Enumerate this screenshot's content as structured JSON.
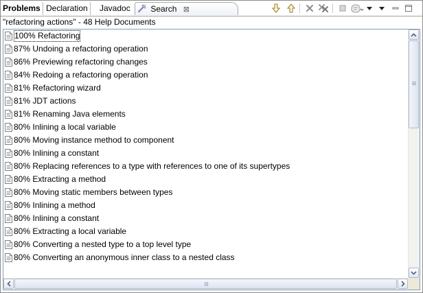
{
  "tabs": [
    {
      "label": "Problems",
      "name": "tab-problems",
      "bold": true
    },
    {
      "label": "Declaration",
      "name": "tab-declaration",
      "bold": false
    },
    {
      "label": "Javadoc",
      "name": "tab-javadoc",
      "bold": false
    },
    {
      "label": "Search",
      "name": "tab-search",
      "bold": false,
      "active": true,
      "icon": "search-icon",
      "close_icon": "close-icon"
    }
  ],
  "tab_close_glyph": "⊠",
  "toolbar": {
    "icons": [
      "next-match-arrow-icon",
      "previous-match-arrow-icon",
      "remove-selected-icon",
      "remove-all-icon",
      "stop-icon",
      "search-history-icon",
      "view-menu-icon",
      "minimize-icon",
      "maximize-icon"
    ]
  },
  "header": {
    "query": "\"refactoring actions\"",
    "separator": " - ",
    "count_text": "48 Help Documents"
  },
  "results": [
    {
      "score": "100%",
      "title": "Refactoring"
    },
    {
      "score": "87%",
      "title": "Undoing a refactoring operation"
    },
    {
      "score": "86%",
      "title": "Previewing refactoring changes"
    },
    {
      "score": "84%",
      "title": "Redoing a refactoring operation"
    },
    {
      "score": "81%",
      "title": "Refactoring wizard"
    },
    {
      "score": "81%",
      "title": "JDT actions"
    },
    {
      "score": "81%",
      "title": "Renaming Java elements"
    },
    {
      "score": "80%",
      "title": "Inlining a local variable"
    },
    {
      "score": "80%",
      "title": "Moving instance method to component"
    },
    {
      "score": "80%",
      "title": "Inlining a constant"
    },
    {
      "score": "80%",
      "title": "Replacing references to a type with references to one of its supertypes"
    },
    {
      "score": "80%",
      "title": "Extracting a method"
    },
    {
      "score": "80%",
      "title": "Moving static members between types"
    },
    {
      "score": "80%",
      "title": "Inlining a method"
    },
    {
      "score": "80%",
      "title": "Inlining a constant"
    },
    {
      "score": "80%",
      "title": "Extracting a local variable"
    },
    {
      "score": "80%",
      "title": "Converting a nested type to a top level type"
    },
    {
      "score": "80%",
      "title": "Converting an anonymous inner class to a nested class"
    }
  ],
  "result_icon": "help-document-icon",
  "colors": {
    "accent": "#7f9db9",
    "scroll_track": "#f2f2ee",
    "scroll_button": "#dfe5f2",
    "stop_red": "#cc3333",
    "arrow_gold": "#c8a040"
  }
}
